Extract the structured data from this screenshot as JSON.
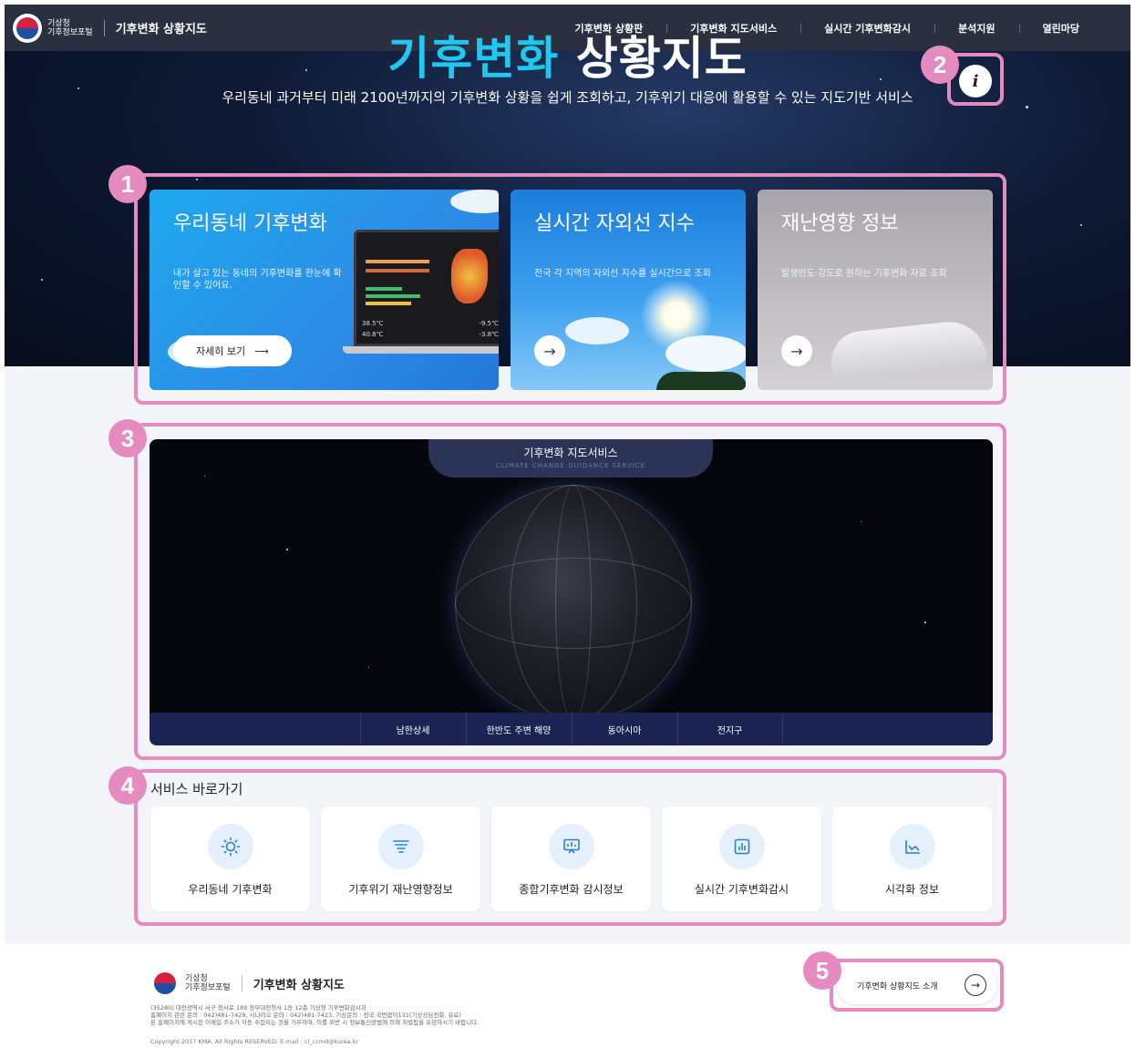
{
  "header": {
    "logo_line1": "기상청",
    "logo_line2": "기후정보포털",
    "site_title": "기후변화 상황지도",
    "nav": [
      "기후변화 상황판",
      "기후변화 지도서비스",
      "실시간 기후변화감시",
      "분석지원",
      "열린마당"
    ]
  },
  "hero": {
    "title_colored": "기후변화",
    "title_white": "상황지도",
    "subtitle": "우리동네 과거부터 미래 2100년까지의 기후변화 상황을 쉽게 조회하고, 기후위기 대응에 활용할 수 있는 지도기반 서비스",
    "info_icon": "i"
  },
  "cards": [
    {
      "title": "우리동네 기후변화",
      "desc": "내가 살고 있는 동네의 기후변화를 한눈에 확인할 수 있어요.",
      "button": "자세히 보기"
    },
    {
      "title": "실시간 자외선 지수",
      "desc": "전국 각 지역의 자외선 지수를 실시간으로 조회"
    },
    {
      "title": "재난영향 정보",
      "desc": "발생빈도·강도로 원하는 기후변화 자료 조회"
    }
  ],
  "laptop_readouts": [
    "38.5℃",
    "-9.5℃",
    "40.8℃",
    "-3.8℃"
  ],
  "map_service": {
    "title": "기후변화 지도서비스",
    "subtitle": "CLIMATE CHANGE GUIDANCE SERVICE",
    "tabs": [
      "남한상세",
      "한반도 주변 해양",
      "동아시아",
      "전지구"
    ]
  },
  "quick": {
    "title": "서비스 바로가기",
    "items": [
      {
        "label": "우리동네 기후변화",
        "icon": "sun-icon"
      },
      {
        "label": "기후위기 재난영향정보",
        "icon": "tornado-icon"
      },
      {
        "label": "종합기후변화 감시정보",
        "icon": "monitor-icon"
      },
      {
        "label": "실시간 기후변화감시",
        "icon": "bar-chart-icon"
      },
      {
        "label": "시각화 정보",
        "icon": "line-chart-icon"
      }
    ]
  },
  "footer": {
    "logo_line1": "기상청",
    "logo_line2": "기후정보포털",
    "site_title": "기후변화 상황지도",
    "address": "(35280) 대전광역시 서구 청사로 189 정부대전청사 1동 12층 기상청 기후변화감시과",
    "contact": "홈페이지 관련 문의 : 042)481-7429, 시나리오 문의 : 042)481-7423, 기상문의 : 전국 국번없이131(기상상담전화, 유료)",
    "notice": "본 홈페이지에 게시된 이메일 주소가 자동 수집되는 것을 거부하며, 이를 위반 시 정보통신망법에 의해 처벌됨을 유념하시기 바랍니다.",
    "copyright": "Copyright 2017 KMA. All Rights RESERVED. E-mail : cl_ccmd@korea.kr",
    "intro_button": "기후변화 상황지도 소개"
  },
  "annotations": [
    "1",
    "2",
    "3",
    "4",
    "5"
  ],
  "colors": {
    "accent": "#20c7f0",
    "header_bg": "#2b3040",
    "highlight": "#e58bbf",
    "map_tabs_bg": "#1b2352"
  }
}
